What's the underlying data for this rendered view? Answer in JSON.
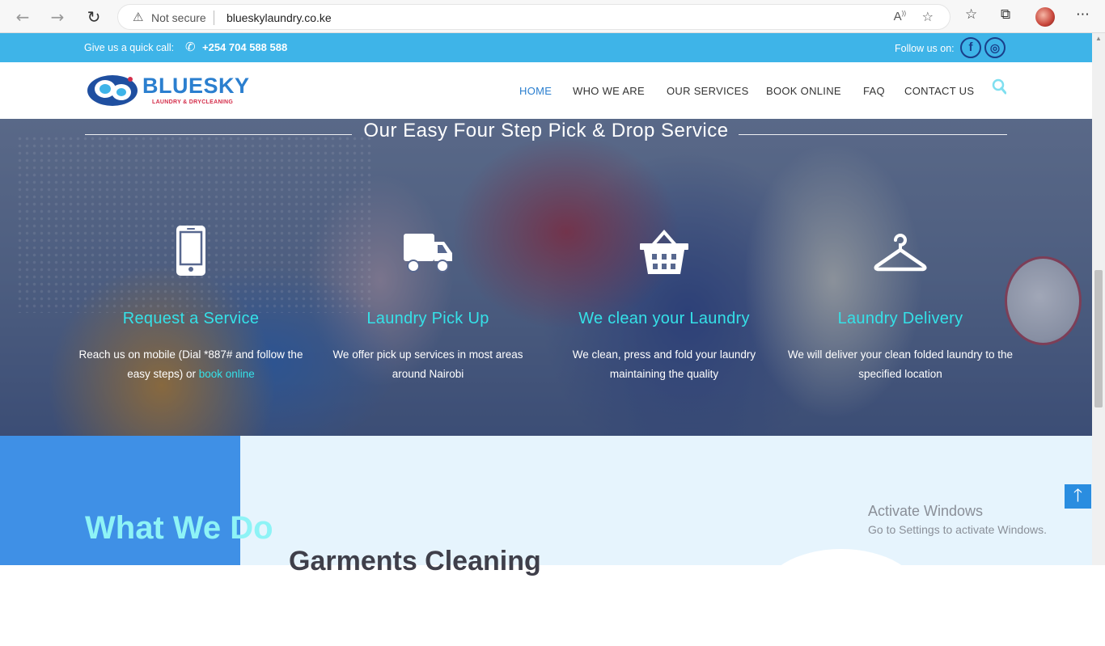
{
  "browser": {
    "back_icon": "arrow-left-icon",
    "forward_icon": "arrow-right-icon",
    "reload_icon": "reload-icon",
    "security_label": "Not secure",
    "url": "blueskylaundry.co.ke"
  },
  "topbar": {
    "call_label": "Give us a quick call:",
    "phone": "+254 704 588 588",
    "follow_label": "Follow us on:",
    "facebook": "f",
    "instagram": "◎"
  },
  "logo": {
    "name": "BLUESKY",
    "tagline": "LAUNDRY & DRYCLEANING"
  },
  "nav": {
    "items": [
      "HOME",
      "WHO WE ARE",
      "OUR SERVICES",
      "BOOK ONLINE",
      "FAQ",
      "CONTACT US"
    ]
  },
  "hero": {
    "title": "Our Easy Four Step Pick & Drop Service",
    "steps": [
      {
        "icon": "mobile-phone-icon",
        "title": "Request a Service",
        "text_a": "Reach us on mobile (Dial *887# and follow the easy steps) or ",
        "link": "book online"
      },
      {
        "icon": "truck-icon",
        "title": "Laundry Pick Up",
        "text": "We offer pick up services in most areas around Nairobi"
      },
      {
        "icon": "basket-icon",
        "title": "We clean your Laundry",
        "text": "We clean, press and fold your laundry maintaining the quality"
      },
      {
        "icon": "hanger-icon",
        "title": "Laundry Delivery",
        "text": "We will deliver your clean folded laundry to the specified location"
      }
    ]
  },
  "lower": {
    "heading": "What We Do",
    "subheading": "Garments Cleaning"
  },
  "windows": {
    "activate": "Activate Windows",
    "activate_sub": "Go to Settings to activate Windows."
  },
  "colors": {
    "accent": "#3eb4e8",
    "step_title": "#35e1e8",
    "brand_blue": "#2b7fcf",
    "brand_red": "#d42d4a"
  }
}
